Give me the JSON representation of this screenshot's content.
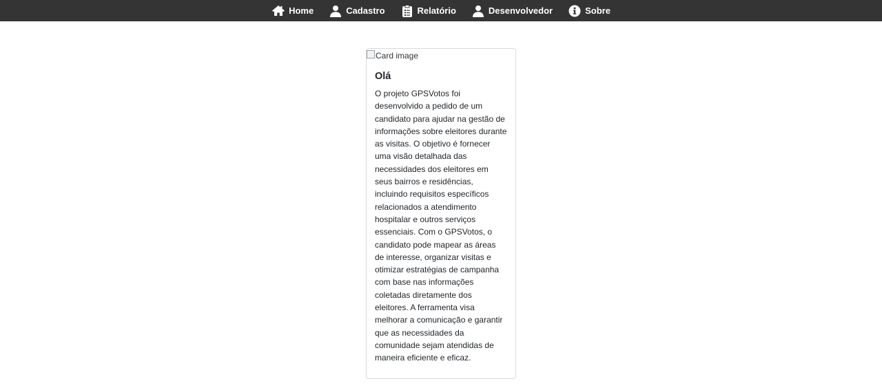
{
  "navbar": {
    "items": [
      {
        "label": "Home",
        "icon": "home-icon"
      },
      {
        "label": "Cadastro",
        "icon": "user-icon"
      },
      {
        "label": "Relatório",
        "icon": "clipboard-icon"
      },
      {
        "label": "Desenvolvedor",
        "icon": "user-icon"
      },
      {
        "label": "Sobre",
        "icon": "info-icon"
      }
    ]
  },
  "card": {
    "image_alt": "Card image",
    "title": "Olá",
    "text": "O projeto GPSVotos foi desenvolvido a pedido de um candidato para ajudar na gestão de informações sobre eleitores durante as visitas. O objetivo é fornecer uma visão detalhada das necessidades dos eleitores em seus bairros e residências, incluindo requisitos específicos relacionados a atendimento hospitalar e outros serviços essenciais. Com o GPSVotos, o candidato pode mapear as áreas de interesse, organizar visitas e otimizar estratégias de campanha com base nas informações coletadas diretamente dos eleitores. A ferramenta visa melhorar a comunicação e garantir que as necessidades da comunidade sejam atendidas de maneira eficiente e eficaz."
  },
  "colors": {
    "navbar_bg": "#343434",
    "navbar_text": "#ffffff",
    "card_border": "#d9d9d9"
  }
}
